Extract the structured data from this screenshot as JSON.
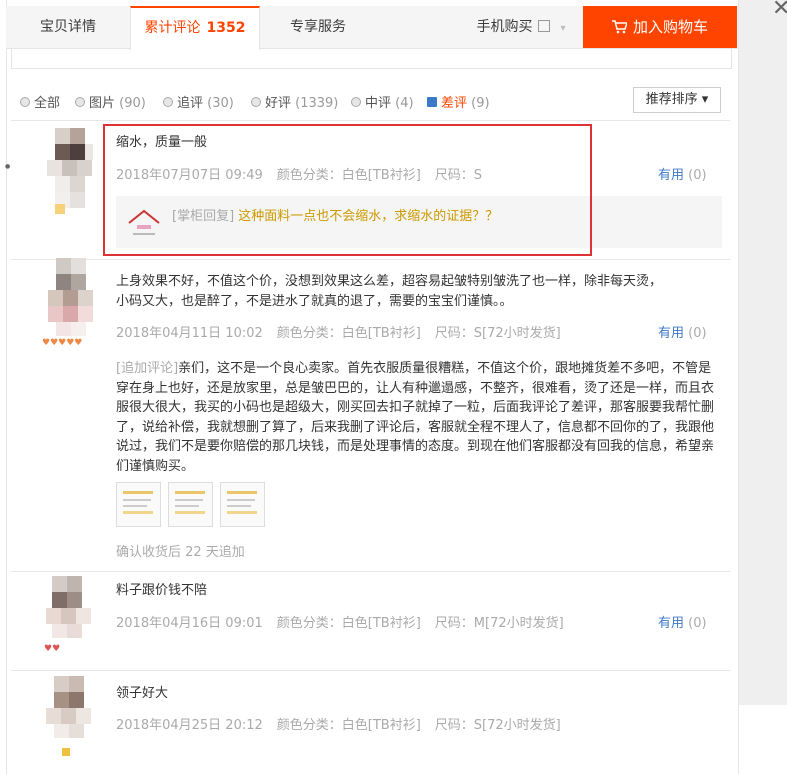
{
  "window": {
    "close_glyph": "✕"
  },
  "tabs": [
    {
      "label": "宝贝详情"
    },
    {
      "label": "累计评论",
      "count": "1352"
    },
    {
      "label": "专享服务"
    },
    {
      "label": "手机购买"
    }
  ],
  "cart_button": {
    "label": "加入购物车",
    "icon": "cart-icon"
  },
  "filter": {
    "options": [
      {
        "label": "全部",
        "count": ""
      },
      {
        "label": "图片",
        "count": "(90)"
      },
      {
        "label": "追评",
        "count": "(30)"
      },
      {
        "label": "好评",
        "count": "(1339)"
      },
      {
        "label": "中评",
        "count": "(4)"
      },
      {
        "label": "差评",
        "count": "(9)"
      }
    ],
    "selected": "差评",
    "sort_label": "推荐排序 ▾"
  },
  "reviews": [
    {
      "text": "缩水，质量一般",
      "date": "2018年07月07日 09:49",
      "color": "颜色分类：白色[TB衬衫]",
      "size": "尺码：S",
      "useful_label": "有用",
      "useful_count": "(0)",
      "reply_tag": "[掌柜回复]",
      "reply_text": "这种面料一点也不会缩水，求缩水的证据？？"
    },
    {
      "text_line1": "上身效果不好，不值这个价，没想到效果这么差，超容易起皱特别皱洗了也一样，除非每天烫，",
      "text_line2": "小码又大，也是醉了，不是进水了就真的退了，需要的宝宝们谨慎。。",
      "date": "2018年04月11日 10:02",
      "color": "颜色分类：白色[TB衬衫]",
      "size": "尺码：S[72小时发货]",
      "useful_label": "有用",
      "useful_count": "(0)",
      "append_tag": "[追加评论]",
      "append_text": "亲们，这不是一个良心卖家。首先衣服质量很糟糕，不值这个价，跟地摊货差不多吧，不管是穿在身上也好，还是放家里，总是皱巴巴的，让人有种邋遢感，不整齐，很难看，烫了还是一样，而且衣服很大很大，我买的小码也是超级大，刚买回去扣子就掉了一粒，后面我评论了差评，那客服要我帮忙删了，说给补偿，我就想删了算了，后来我删了评论后，客服就全程不理人了，信息都不回你的了，我跟他说过，我们不是要你赔偿的那几块钱，而是处理事情的态度。到现在他们客服都没有回我的信息，希望亲们谨慎购买。",
      "append_later": "确认收货后 22 天追加"
    },
    {
      "text": "料子跟价钱不陪",
      "date": "2018年04月16日 09:01",
      "color": "颜色分类：白色[TB衬衫]",
      "size": "尺码：M[72小时发货]",
      "useful_label": "有用",
      "useful_count": "(0)"
    },
    {
      "text": "领子好大",
      "date": "2018年04月25日 20:12",
      "color": "颜色分类：白色[TB衬衫]",
      "size": "尺码：S[72小时发货]"
    }
  ],
  "colors": {
    "accent": "#ff4400",
    "link": "#3d7ac6",
    "highlight_box": "#dd3333"
  }
}
